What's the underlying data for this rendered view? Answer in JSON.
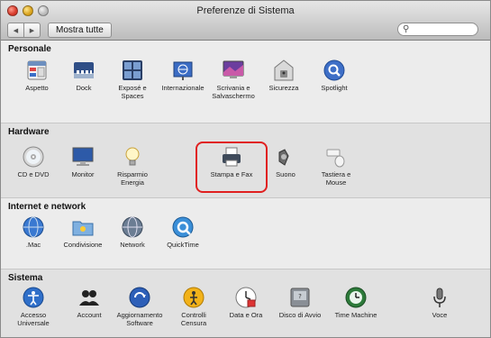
{
  "window": {
    "title": "Preferenze di Sistema"
  },
  "toolbar": {
    "back_glyph": "◀",
    "forward_glyph": "▶",
    "show_all_label": "Mostra tutte"
  },
  "search": {
    "placeholder": "",
    "icon": "search-icon"
  },
  "sections": {
    "personal": {
      "title": "Personale",
      "items": [
        {
          "label": "Aspetto",
          "icon": "appearance-icon"
        },
        {
          "label": "Dock",
          "icon": "dock-icon"
        },
        {
          "label": "Exposé e\nSpaces",
          "icon": "expose-spaces-icon"
        },
        {
          "label": "Internazionale",
          "icon": "international-icon"
        },
        {
          "label": "Scrivania e\nSalvaschermo",
          "icon": "desktop-screensaver-icon"
        },
        {
          "label": "Sicurezza",
          "icon": "security-icon"
        },
        {
          "label": "Spotlight",
          "icon": "spotlight-icon"
        }
      ]
    },
    "hardware": {
      "title": "Hardware",
      "items": [
        {
          "label": "CD e DVD",
          "icon": "cd-dvd-icon"
        },
        {
          "label": "Monitor",
          "icon": "monitor-icon"
        },
        {
          "label": "Risparmio\nEnergia",
          "icon": "energy-saver-icon"
        },
        {
          "label": "Stampa e Fax",
          "icon": "print-fax-icon",
          "highlighted": true
        },
        {
          "label": "Suono",
          "icon": "sound-icon"
        },
        {
          "label": "Tastiera e\nMouse",
          "icon": "keyboard-mouse-icon"
        }
      ]
    },
    "internet": {
      "title": "Internet e network",
      "items": [
        {
          "label": ".Mac",
          "icon": "dotmac-icon"
        },
        {
          "label": "Condivisione",
          "icon": "sharing-icon"
        },
        {
          "label": "Network",
          "icon": "network-icon"
        },
        {
          "label": "QuickTime",
          "icon": "quicktime-icon"
        }
      ]
    },
    "system": {
      "title": "Sistema",
      "items": [
        {
          "label": "Accesso\nUniversale",
          "icon": "universal-access-icon"
        },
        {
          "label": "Account",
          "icon": "accounts-icon"
        },
        {
          "label": "Aggiornamento\nSoftware",
          "icon": "software-update-icon"
        },
        {
          "label": "Controlli\nCensura",
          "icon": "parental-controls-icon"
        },
        {
          "label": "Data e Ora",
          "icon": "date-time-icon"
        },
        {
          "label": "Disco di Avvio",
          "icon": "startup-disk-icon"
        },
        {
          "label": "Time Machine",
          "icon": "time-machine-icon"
        },
        {
          "label": "Voce",
          "icon": "speech-icon"
        }
      ]
    }
  },
  "colors": {
    "highlight": "#e02020"
  }
}
